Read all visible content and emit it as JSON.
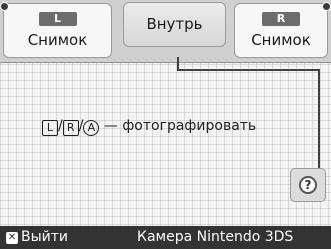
{
  "top_bar": {
    "left_tab": {
      "button_key": "L",
      "label": "Снимок"
    },
    "center_tab": {
      "label": "Внутрь"
    },
    "right_tab": {
      "button_key": "R",
      "label": "Снимок"
    }
  },
  "hint": {
    "keys": [
      "L",
      "R",
      "A"
    ],
    "separator": "/",
    "text": "— фотографировать"
  },
  "help_button": {
    "symbol": "?",
    "icon": "help-icon"
  },
  "bottom_bar": {
    "exit_key": "✕",
    "exit_label": "Выйти",
    "app_title": "Камера Nintendo 3DS"
  }
}
